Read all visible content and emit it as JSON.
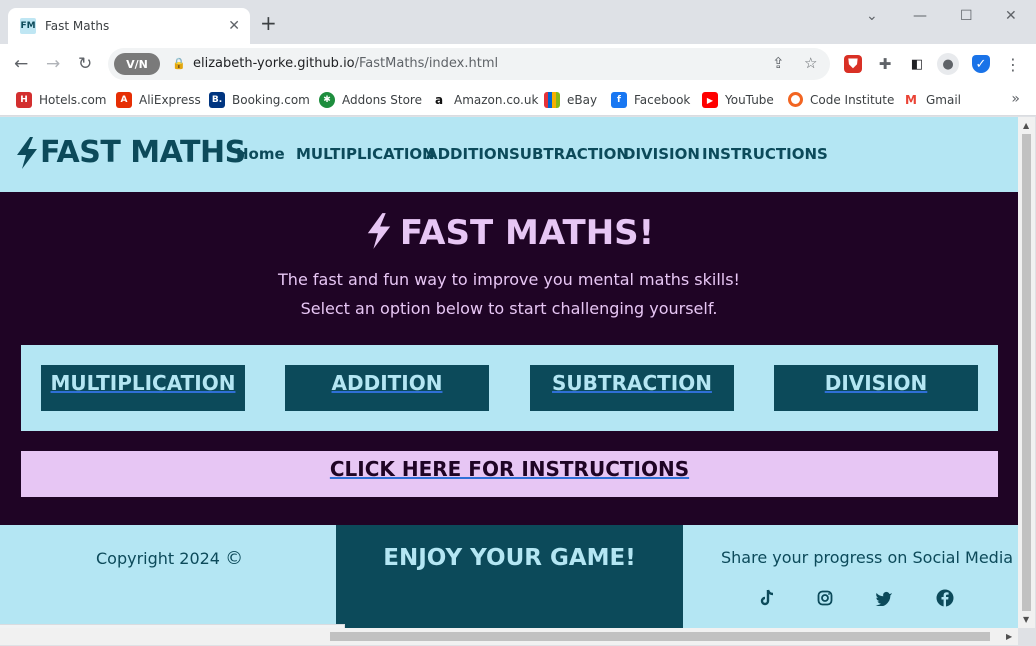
{
  "browser": {
    "tab_title": "Fast Maths",
    "favicon_text": "FM",
    "url_host": "elizabeth-yorke.github.io",
    "url_path": "/FastMaths/index.html",
    "vpn_label": "V/N",
    "status_url": "https://elizabeth-yorke.github.io/FastMaths/instructions.html",
    "bookmarks": [
      {
        "label": "Hotels.com",
        "color": "#d32f2f"
      },
      {
        "label": "AliExpress",
        "color": "#e62e04"
      },
      {
        "label": "Booking.com",
        "color": "#003580"
      },
      {
        "label": "Addons Store",
        "color": "#1e8e3e"
      },
      {
        "label": "Amazon.co.uk",
        "color": "#111111"
      },
      {
        "label": "eBay",
        "color": "#e53238"
      },
      {
        "label": "Facebook",
        "color": "#1877f2"
      },
      {
        "label": "YouTube",
        "color": "#ff0000"
      },
      {
        "label": "Code Institute",
        "color": "#f26522"
      },
      {
        "label": "Gmail",
        "color": "#ea4335"
      }
    ]
  },
  "site": {
    "logo_text": "FAST MATHS",
    "nav": [
      "Home",
      "MULTIPLICATION",
      "ADDITION",
      "SUBTRACTION",
      "DIVISION",
      "INSTRUCTIONS"
    ],
    "hero_title": "FAST MATHS!",
    "hero_line1": "The fast and fun way to improve you mental maths skills!",
    "hero_line2": "Select an option below to start challenging yourself.",
    "options": [
      "MULTIPLICATION",
      "ADDITION",
      "SUBTRACTION",
      "DIVISION"
    ],
    "instructions_label": "CLICK HERE FOR INSTRUCTIONS",
    "footer": {
      "copyright": "Copyright 2024",
      "enjoy": "ENJOY YOUR GAME!",
      "share": "Share your progress on Social Media"
    },
    "colors": {
      "light_blue": "#b4e6f3",
      "dark_teal": "#0c4a5a",
      "deep_purple": "#1f0425",
      "lavender": "#e7c6f4"
    }
  }
}
